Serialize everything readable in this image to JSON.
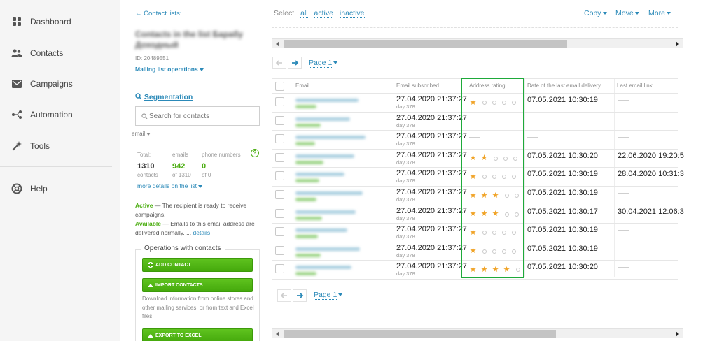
{
  "sidebar": {
    "items": [
      {
        "label": "Dashboard",
        "icon": "dashboard-icon"
      },
      {
        "label": "Contacts",
        "icon": "contacts-icon"
      },
      {
        "label": "Campaigns",
        "icon": "campaigns-icon"
      },
      {
        "label": "Automation",
        "icon": "automation-icon"
      },
      {
        "label": "Tools",
        "icon": "tools-icon"
      },
      {
        "label": "Help",
        "icon": "help-icon"
      }
    ]
  },
  "list_panel": {
    "back_link": "← Contact lists:",
    "list_name_line1": "Contacts in the list Барабу",
    "list_name_line2": "Доходный",
    "list_id": "ID: 20489551",
    "operations_link": "Mailing list operations",
    "segmentation_label": "Segmentation",
    "search_placeholder": "Search for contacts",
    "filter_field": "email",
    "stats": {
      "total_header": "Total:",
      "emails_header": "emails",
      "phones_header": "phone numbers",
      "total_value": "1310",
      "total_caption": "contacts",
      "emails_value": "942",
      "emails_caption": "of 1310",
      "phones_value": "0",
      "phones_caption": "of 0"
    },
    "more_details": "more details on the list",
    "active_term": "Active",
    "active_desc": " — The recipient is ready to receive campaigns.",
    "available_term": "Available",
    "available_desc": " — Emails to this email address are delivered normally. ...",
    "details_link": "details",
    "operations_title": "Operations with contacts",
    "add_contact": "ADD CONTACT",
    "import_contacts": "IMPORT CONTACTS",
    "import_desc": "Download information from online stores and other mailing services, or from text and Excel files.",
    "export_excel": "EXPORT TO EXCEL"
  },
  "toolbar": {
    "select_label": "Select",
    "select_all": "all",
    "select_active": "active",
    "select_inactive": "inactive",
    "copy": "Copy",
    "move": "Move",
    "more": "More"
  },
  "pager": {
    "page_label": "Page 1"
  },
  "table": {
    "headers": {
      "email": "Email",
      "subscribed": "Email subscribed",
      "rating": "Address rating",
      "delivery": "Date of the last email delivery",
      "last_link": "Last email link"
    },
    "rows": [
      {
        "subscribed": "27.04.2020 21:37:27",
        "day": "day 378",
        "rating": 1,
        "delivery": "07.05.2021 10:30:19",
        "last_link": ""
      },
      {
        "subscribed": "27.04.2020 21:37:27",
        "day": "day 378",
        "rating": 0,
        "delivery": "",
        "last_link": ""
      },
      {
        "subscribed": "27.04.2020 21:37:27",
        "day": "day 378",
        "rating": 0,
        "delivery": "",
        "last_link": ""
      },
      {
        "subscribed": "27.04.2020 21:37:27",
        "day": "day 378",
        "rating": 2,
        "delivery": "07.05.2021 10:30:20",
        "last_link": "22.06.2020 19:20:5"
      },
      {
        "subscribed": "27.04.2020 21:37:27",
        "day": "day 378",
        "rating": 1,
        "delivery": "07.05.2021 10:30:19",
        "last_link": "28.04.2020 10:31:3"
      },
      {
        "subscribed": "27.04.2020 21:37:27",
        "day": "day 378",
        "rating": 3,
        "delivery": "07.05.2021 10:30:19",
        "last_link": ""
      },
      {
        "subscribed": "27.04.2020 21:37:27",
        "day": "day 378",
        "rating": 3,
        "delivery": "07.05.2021 10:30:17",
        "last_link": "30.04.2021 12:06:3"
      },
      {
        "subscribed": "27.04.2020 21:37:27",
        "day": "day 378",
        "rating": 1,
        "delivery": "07.05.2021 10:30:19",
        "last_link": ""
      },
      {
        "subscribed": "27.04.2020 21:37:27",
        "day": "day 378",
        "rating": 1,
        "delivery": "07.05.2021 10:30:19",
        "last_link": ""
      },
      {
        "subscribed": "27.04.2020 21:37:27",
        "day": "day 378",
        "rating": 4,
        "delivery": "07.05.2021 10:30:20",
        "last_link": ""
      }
    ]
  },
  "colors": {
    "accent_link": "#2a89b8",
    "green_button": "#4cae12",
    "star": "#f0a326",
    "highlight_border": "#1eaa3a"
  }
}
